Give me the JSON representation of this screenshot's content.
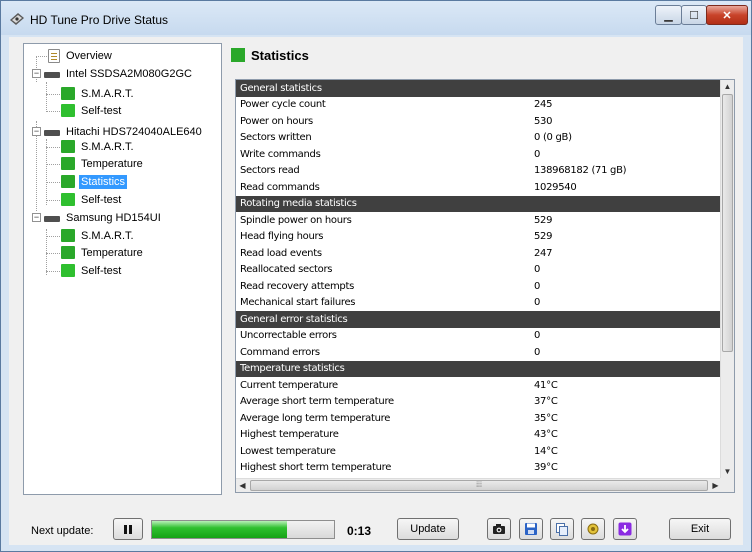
{
  "window": {
    "title": "HD Tune Pro Drive Status"
  },
  "tree": {
    "overview": "Overview",
    "drives": [
      {
        "name": "Intel SSDSA2M080G2GC",
        "children": [
          "S.M.A.R.T.",
          "Self-test"
        ]
      },
      {
        "name": "Hitachi HDS724040ALE640",
        "children": [
          "S.M.A.R.T.",
          "Temperature",
          "Statistics",
          "Self-test"
        ]
      },
      {
        "name": "Samsung HD154UI",
        "children": [
          "S.M.A.R.T.",
          "Temperature",
          "Self-test"
        ]
      }
    ],
    "selected": "Statistics"
  },
  "panel": {
    "title": "Statistics"
  },
  "stats": {
    "sections": [
      {
        "title": "General statistics",
        "rows": [
          [
            "Power cycle count",
            "245"
          ],
          [
            "Power on hours",
            "530"
          ],
          [
            "Sectors written",
            "0 (0 gB)"
          ],
          [
            "Write commands",
            "0"
          ],
          [
            "Sectors read",
            "138968182 (71 gB)"
          ],
          [
            "Read commands",
            "1029540"
          ]
        ]
      },
      {
        "title": "Rotating media statistics",
        "rows": [
          [
            "Spindle power on hours",
            "529"
          ],
          [
            "Head flying hours",
            "529"
          ],
          [
            "Read load events",
            "247"
          ],
          [
            "Reallocated sectors",
            "0"
          ],
          [
            "Read recovery attempts",
            "0"
          ],
          [
            "Mechanical start failures",
            "0"
          ]
        ]
      },
      {
        "title": "General error statistics",
        "rows": [
          [
            "Uncorrectable errors",
            "0"
          ],
          [
            "Command errors",
            "0"
          ]
        ]
      },
      {
        "title": "Temperature statistics",
        "rows": [
          [
            "Current temperature",
            "41°C"
          ],
          [
            "Average short term temperature",
            "37°C"
          ],
          [
            "Average long term temperature",
            "35°C"
          ],
          [
            "Highest temperature",
            "43°C"
          ],
          [
            "Lowest temperature",
            "14°C"
          ],
          [
            "Highest short term temperature",
            "39°C"
          ]
        ]
      }
    ]
  },
  "bottom": {
    "next_update_label": "Next update:",
    "progress": 0.74,
    "timer": "0:13",
    "update_label": "Update",
    "exit_label": "Exit"
  },
  "colors": {
    "accent_green": "#2aa82a",
    "selection": "#3399ff",
    "section_header": "#404040"
  }
}
